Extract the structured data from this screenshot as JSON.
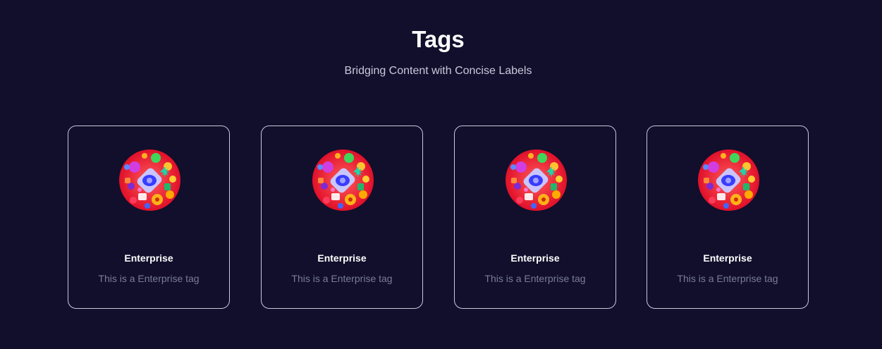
{
  "header": {
    "title": "Tags",
    "subtitle": "Bridging Content with Concise Labels"
  },
  "colors": {
    "background": "#110f2b",
    "card_border": "#c9c8da",
    "title": "#ffffff",
    "subtitle": "#c8c9dc",
    "description": "#7a7c98"
  },
  "tags": [
    {
      "name": "Enterprise",
      "description": "This is a Enterprise tag",
      "icon": "tag-avatar-icon"
    },
    {
      "name": "Enterprise",
      "description": "This is a Enterprise tag",
      "icon": "tag-avatar-icon"
    },
    {
      "name": "Enterprise",
      "description": "This is a Enterprise tag",
      "icon": "tag-avatar-icon"
    },
    {
      "name": "Enterprise",
      "description": "This is a Enterprise tag",
      "icon": "tag-avatar-icon"
    }
  ]
}
